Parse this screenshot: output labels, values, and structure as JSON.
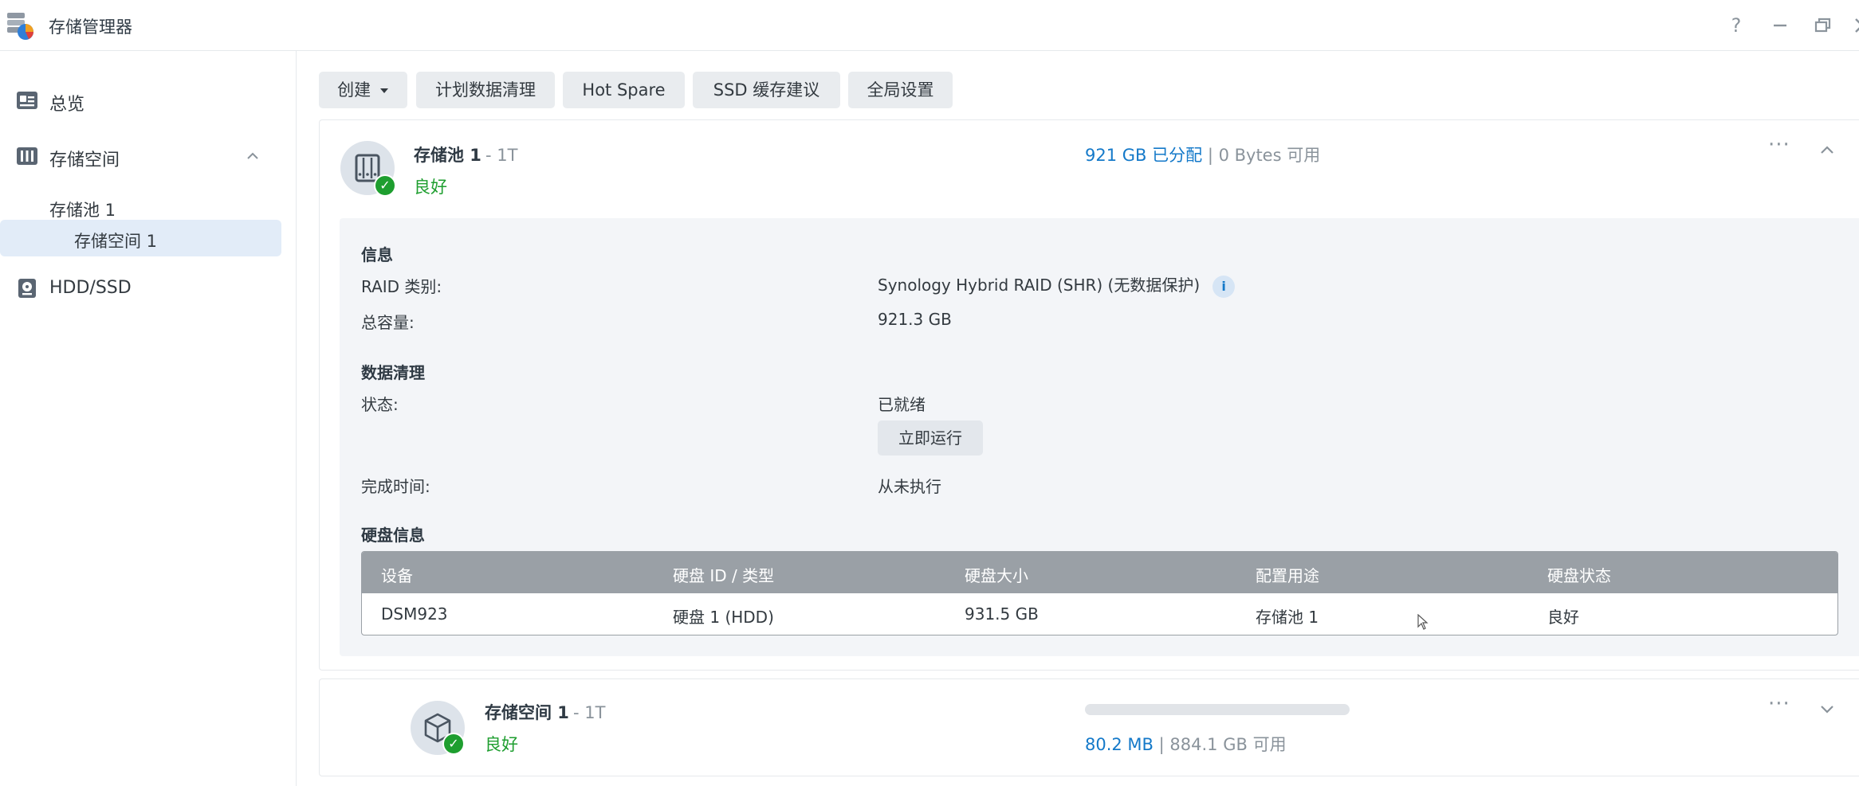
{
  "window": {
    "title": "存储管理器",
    "controls": [
      "help-icon",
      "minimize-icon",
      "restore-icon",
      "close-icon"
    ]
  },
  "sidebar": {
    "overview": "总览",
    "storage": "存储空间",
    "pool": "存储池 1",
    "volume": "存储空间 1",
    "hdd": "HDD/SSD"
  },
  "toolbar": {
    "create": "创建",
    "schedule": "计划数据清理",
    "hotspare": "Hot Spare",
    "ssd": "SSD 缓存建议",
    "global": "全局设置"
  },
  "pool": {
    "name": "存储池 1",
    "suffix": "- 1T",
    "status": "良好",
    "allocated": "921 GB 已分配",
    "separator": "|",
    "available": "0 Bytes 可用",
    "info_title": "信息",
    "raid_label": "RAID 类别:",
    "raid_value": "Synology Hybrid RAID (SHR) (无数据保护)",
    "capacity_label": "总容量:",
    "capacity_value": "921.3 GB",
    "scrub_title": "数据清理",
    "scrub_status_label": "状态:",
    "scrub_status_value": "已就绪",
    "run_now": "立即运行",
    "finish_label": "完成时间:",
    "finish_value": "从未执行",
    "disk_title": "硬盘信息",
    "table": {
      "headers": [
        "设备",
        "硬盘 ID / 类型",
        "硬盘大小",
        "配置用途",
        "硬盘状态"
      ],
      "rows": [
        [
          "DSM923",
          "硬盘 1 (HDD)",
          "931.5 GB",
          "存储池 1",
          "良好"
        ]
      ]
    }
  },
  "volume": {
    "name": "存储空间 1",
    "suffix": "- 1T",
    "status": "良好",
    "used": "80.2 MB",
    "separator": "|",
    "available": "884.1 GB 可用",
    "usage_fraction": 0.0001
  },
  "colors": {
    "accent": "#1479c9",
    "success": "#1e9e2f",
    "table_header": "#9aa0a6"
  }
}
